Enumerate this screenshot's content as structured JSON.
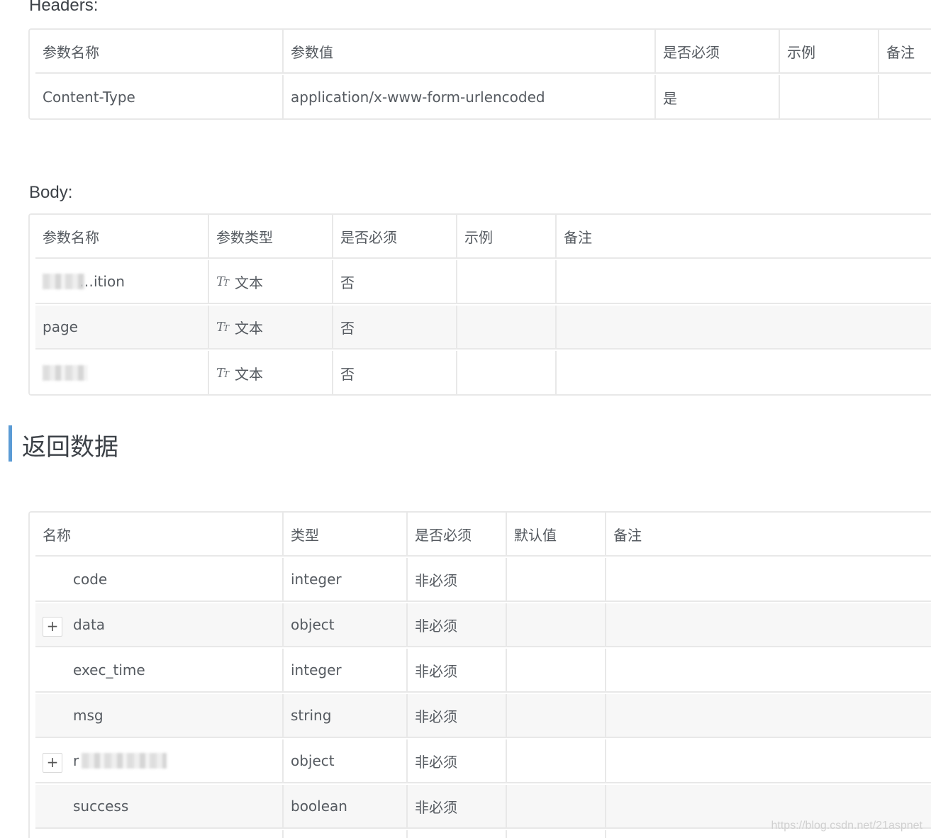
{
  "headers_section": {
    "label": "Headers:",
    "columns": [
      "参数名称",
      "参数值",
      "是否必须",
      "示例",
      "备注"
    ],
    "rows": [
      [
        "Content-Type",
        "application/x-www-form-urlencoded",
        "是",
        "",
        ""
      ]
    ]
  },
  "body_section": {
    "label": "Body:",
    "columns": [
      "参数名称",
      "参数类型",
      "是否必须",
      "示例",
      "备注"
    ],
    "type_icon": "Tт",
    "rows": [
      {
        "name": "",
        "name_suffix": "…ition",
        "type": "文本",
        "required": "否",
        "example": "",
        "note": ""
      },
      {
        "name": "page",
        "type": "文本",
        "required": "否",
        "example": "",
        "note": ""
      },
      {
        "name": "",
        "type": "文本",
        "required": "否",
        "example": "",
        "note": ""
      }
    ]
  },
  "return_section": {
    "title": "返回数据",
    "accent_color": "#5b9bd5",
    "columns": [
      "名称",
      "类型",
      "是否必须",
      "默认值",
      "备注"
    ],
    "expand_label": "+",
    "rows": [
      {
        "name": "code",
        "type": "integer",
        "required": "非必须",
        "expandable": false
      },
      {
        "name": "data",
        "type": "object",
        "required": "非必须",
        "expandable": true
      },
      {
        "name": "exec_time",
        "type": "integer",
        "required": "非必须",
        "expandable": false
      },
      {
        "name": "msg",
        "type": "string",
        "required": "非必须",
        "expandable": false
      },
      {
        "name": "r",
        "type": "object",
        "required": "非必须",
        "expandable": true
      },
      {
        "name": "success",
        "type": "boolean",
        "required": "非必须",
        "expandable": false
      }
    ]
  },
  "watermark": "https://blog.csdn.net/21aspnet"
}
